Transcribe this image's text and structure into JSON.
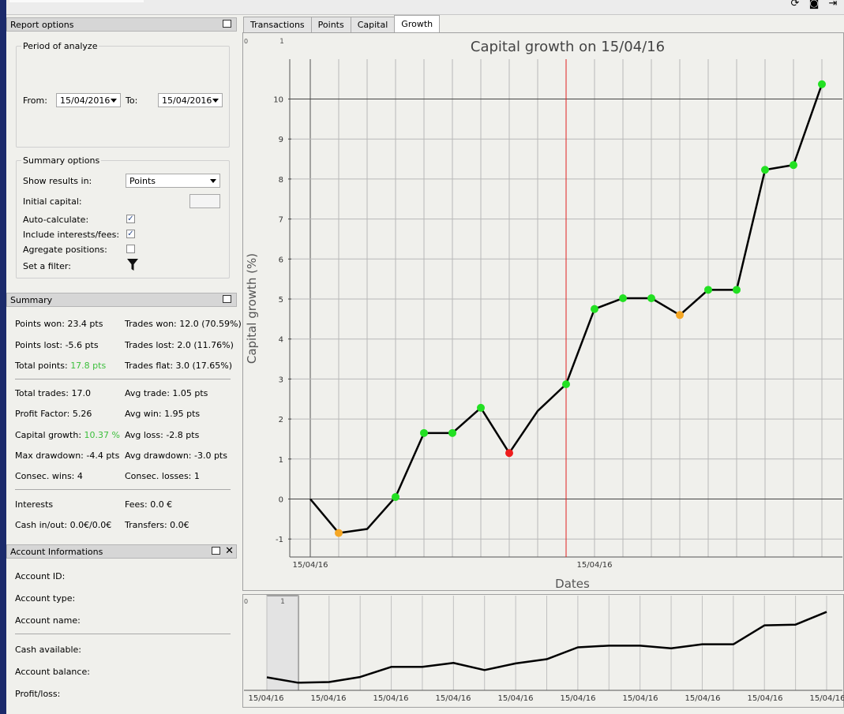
{
  "window": {
    "toolbar_icons": [
      "refresh-icon",
      "camera-icon",
      "exit-icon"
    ]
  },
  "report_options": {
    "title": "Report options",
    "period": {
      "title": "Period of analyze",
      "from_label": "From:",
      "from_value": "15/04/2016",
      "to_label": "To:",
      "to_value": "15/04/2016"
    },
    "summary_options": {
      "title": "Summary options",
      "show_results_label": "Show results in:",
      "show_results_value": "Points",
      "initial_capital_label": "Initial capital:",
      "auto_calculate_label": "Auto-calculate:",
      "auto_calculate_checked": true,
      "include_interests_label": "Include interests/fees:",
      "include_interests_checked": true,
      "aggregate_label": "Agregate positions:",
      "aggregate_checked": false,
      "filter_label": "Set a filter:"
    }
  },
  "summary": {
    "title": "Summary",
    "points_won": "Points won: 23.4 pts",
    "trades_won": "Trades won: 12.0 (70.59%)",
    "points_lost": "Points lost: -5.6 pts",
    "trades_lost": "Trades lost: 2.0 (11.76%)",
    "total_points_label": "Total points:",
    "total_points_value": "17.8 pts",
    "trades_flat": "Trades flat: 3.0 (17.65%)",
    "total_trades": "Total trades: 17.0",
    "avg_trade": "Avg trade: 1.05 pts",
    "profit_factor": "Profit Factor: 5.26",
    "avg_win": "Avg win: 1.95 pts",
    "capital_growth_label": "Capital growth:",
    "capital_growth_value": "10.37 %",
    "avg_loss": "Avg loss: -2.8 pts",
    "max_drawdown": "Max drawdown: -4.4 pts",
    "avg_drawdown": "Avg drawdown: -3.0 pts",
    "consec_wins": "Consec. wins: 4",
    "consec_losses": "Consec. losses: 1",
    "interests": "Interests",
    "fees": "Fees: 0.0 €",
    "cash_in_out": "Cash in/out: 0.0€/0.0€",
    "transfers": "Transfers: 0.0€"
  },
  "account": {
    "title": "Account Informations",
    "account_id": "Account ID:",
    "account_type": "Account type:",
    "account_name": "Account name:",
    "cash_available": "Cash available:",
    "account_balance": "Account balance:",
    "profit_loss": "Profit/loss:"
  },
  "tabs": [
    "Transactions",
    "Points",
    "Capital",
    "Growth"
  ],
  "active_tab": "Growth",
  "chart_data": {
    "type": "line",
    "title": "Capital growth on 15/04/16",
    "xlabel": "Dates",
    "ylabel": "Capital growth (%)",
    "ylim": [
      -1.5,
      11
    ],
    "yticks": [
      -1,
      0,
      1,
      2,
      3,
      4,
      5,
      6,
      7,
      8,
      9,
      10
    ],
    "x_tick_labels": [
      "15/04/16",
      "15/04/16"
    ],
    "corner_labels": [
      "0",
      "1"
    ],
    "values": [
      0,
      -0.85,
      -0.75,
      0.05,
      1.65,
      1.65,
      2.28,
      1.15,
      2.2,
      2.87,
      4.75,
      5.02,
      5.02,
      4.6,
      5.23,
      5.23,
      8.23,
      8.35,
      10.37
    ],
    "markers": [
      "none",
      "orange",
      "none",
      "green",
      "green",
      "green",
      "green",
      "red",
      "none",
      "green",
      "green",
      "green",
      "green",
      "orange",
      "green",
      "green",
      "green",
      "green",
      "green"
    ],
    "marker_colors": {
      "green": "#22e022",
      "orange": "#f5a623",
      "red": "#ee1c1c"
    },
    "line_color": "#000000",
    "red_cursor_index": 9,
    "grid": true
  },
  "overview_chart": {
    "corner_labels": [
      "0",
      "1"
    ],
    "x_tick_labels": [
      "15/04/16",
      "15/04/16",
      "15/04/16",
      "15/04/16",
      "15/04/16",
      "15/04/16",
      "15/04/16",
      "15/04/16",
      "15/04/16",
      "15/04/16"
    ]
  }
}
